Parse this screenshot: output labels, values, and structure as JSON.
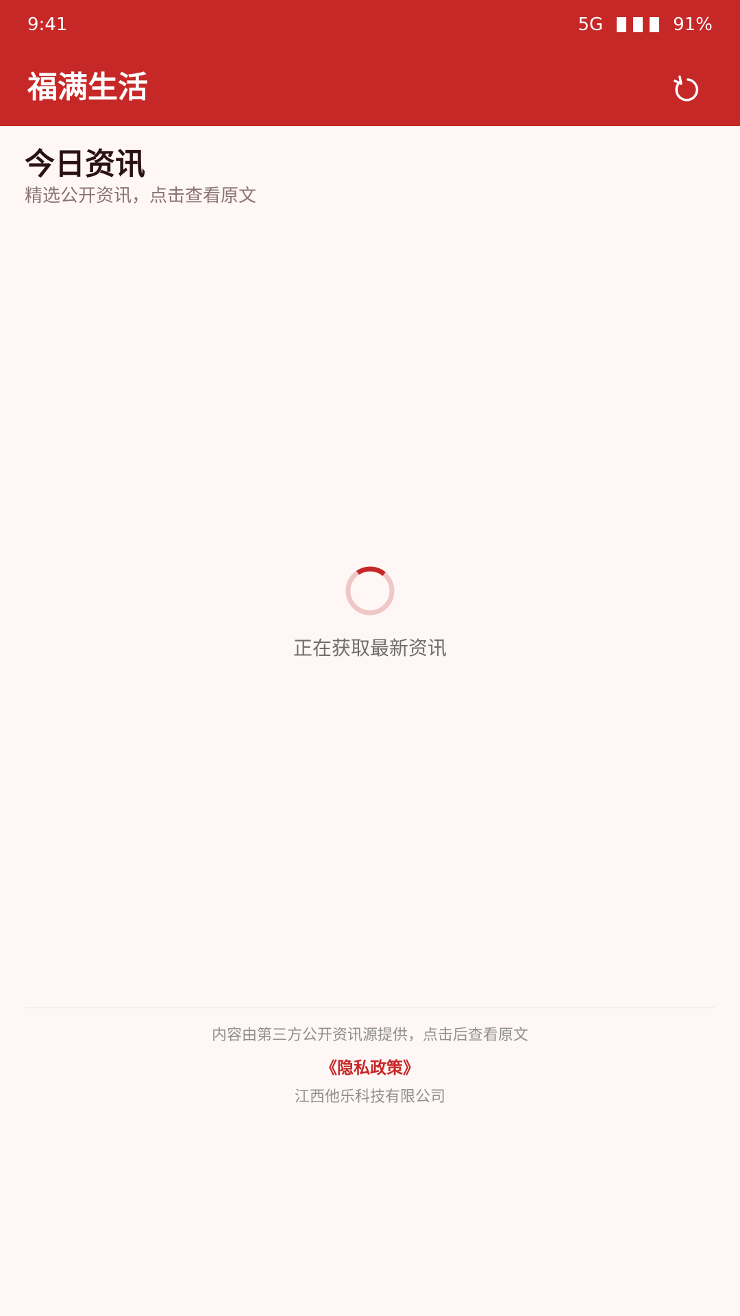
{
  "status_bar": {
    "time": "9:41",
    "network": "5G",
    "battery": "91%"
  },
  "app_bar": {
    "title": "福满生活",
    "refresh_icon": "refresh-icon"
  },
  "section": {
    "title": "今日资讯",
    "subtitle": "精选公开资讯，点击查看原文"
  },
  "loading": {
    "text": "正在获取最新资讯",
    "spinner_icon": "loading-spinner-icon"
  },
  "footer": {
    "note": "内容由第三方公开资讯源提供，点击后查看原文",
    "privacy_link": "《隐私政策》",
    "company": "江西他乐科技有限公司"
  },
  "colors": {
    "primary": "#c62828",
    "background": "#fff7f5",
    "spinner_track": "#f0c7c7"
  }
}
